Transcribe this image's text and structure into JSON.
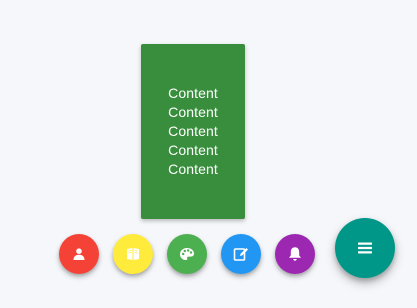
{
  "content_card": {
    "lines": [
      "Content",
      "Content",
      "Content",
      "Content",
      "Content"
    ],
    "color": "#388e3c"
  },
  "fab_menu": {
    "items": [
      {
        "icon": "user-icon",
        "color": "#f44336"
      },
      {
        "icon": "book-icon",
        "color": "#ffeb3b"
      },
      {
        "icon": "palette-icon",
        "color": "#4caf50"
      },
      {
        "icon": "edit-icon",
        "color": "#2196f3"
      },
      {
        "icon": "bell-icon",
        "color": "#9c27b0"
      }
    ],
    "main": {
      "icon": "menu-icon",
      "color": "#009688"
    }
  }
}
